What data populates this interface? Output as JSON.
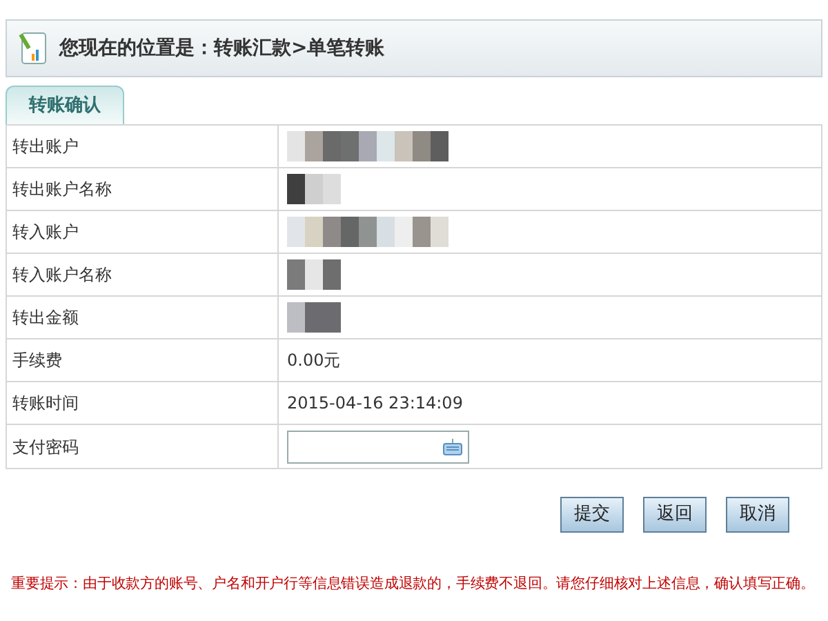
{
  "breadcrumb": {
    "label": "您现在的位置是：",
    "path": "转账汇款>单笔转账"
  },
  "tabs": [
    {
      "label": "转账确认",
      "selected": true
    }
  ],
  "rows": [
    {
      "label": "转出账户",
      "kind": "redacted"
    },
    {
      "label": "转出账户名称",
      "kind": "redacted"
    },
    {
      "label": "转入账户",
      "kind": "redacted"
    },
    {
      "label": "转入账户名称",
      "kind": "redacted"
    },
    {
      "label": "转出金额",
      "kind": "redacted"
    },
    {
      "label": "手续费",
      "kind": "text",
      "value": "0.00元"
    },
    {
      "label": "转账时间",
      "kind": "text",
      "value": "2015-04-16 23:14:09"
    },
    {
      "label": "支付密码",
      "kind": "password"
    }
  ],
  "buttons": [
    "提交",
    "返回",
    "取消"
  ],
  "notice": "重要提示：由于收款方的账号、户名和开户行等信息错误造成退款的，手续费不退回。请您仔细核对上述信息，确认填写正确。"
}
